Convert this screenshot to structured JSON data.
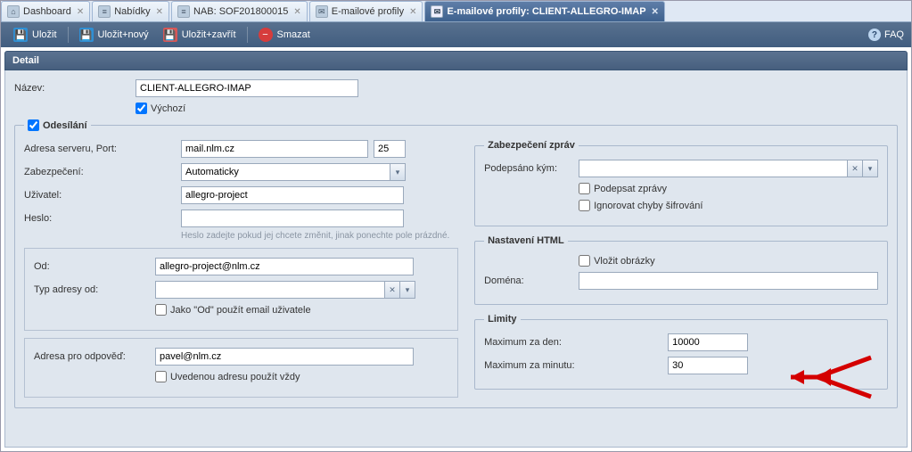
{
  "tabs": [
    {
      "label": "Dashboard",
      "icon": ""
    },
    {
      "label": "Nabídky",
      "icon": "≡"
    },
    {
      "label": "NAB: SOF201800015",
      "icon": "≡"
    },
    {
      "label": "E-mailové profily",
      "icon": "✉"
    },
    {
      "label": "E-mailové profily: CLIENT-ALLEGRO-IMAP",
      "icon": "✉",
      "active": true
    }
  ],
  "toolbar": {
    "save": "Uložit",
    "save_new": "Uložit+nový",
    "save_close": "Uložit+zavřít",
    "delete": "Smazat",
    "faq": "FAQ"
  },
  "section_title": "Detail",
  "name_label": "Název:",
  "name_value": "CLIENT-ALLEGRO-IMAP",
  "default_label": "Výchozí",
  "default_checked": true,
  "sending_legend": "Odesílání",
  "sending_checked": true,
  "server_label": "Adresa serveru, Port:",
  "server_host": "mail.nlm.cz",
  "server_port": "25",
  "security_label": "Zabezpečení:",
  "security_value": "Automaticky",
  "user_label": "Uživatel:",
  "user_value": "allegro-project",
  "pwd_label": "Heslo:",
  "pwd_hint": "Heslo zadejte pokud jej chcete změnit, jinak ponechte pole prázdné.",
  "from_label": "Od:",
  "from_value": "allegro-project@nlm.cz",
  "from_type_label": "Typ adresy od:",
  "from_use_user_email": "Jako \"Od\" použít email uživatele",
  "reply_label": "Adresa pro odpověď:",
  "reply_value": "pavel@nlm.cz",
  "reply_always": "Uvedenou adresu použít vždy",
  "msgsec_legend": "Zabezpečení zpráv",
  "signed_by_label": "Podepsáno kým:",
  "sign_messages": "Podepsat zprávy",
  "ignore_enc_errors": "Ignorovat chyby šifrování",
  "html_legend": "Nastavení HTML",
  "embed_images": "Vložit obrázky",
  "domain_label": "Doména:",
  "limits_legend": "Limity",
  "max_day_label": "Maximum za den:",
  "max_day_value": "10000",
  "max_min_label": "Maximum za minutu:",
  "max_min_value": "30"
}
